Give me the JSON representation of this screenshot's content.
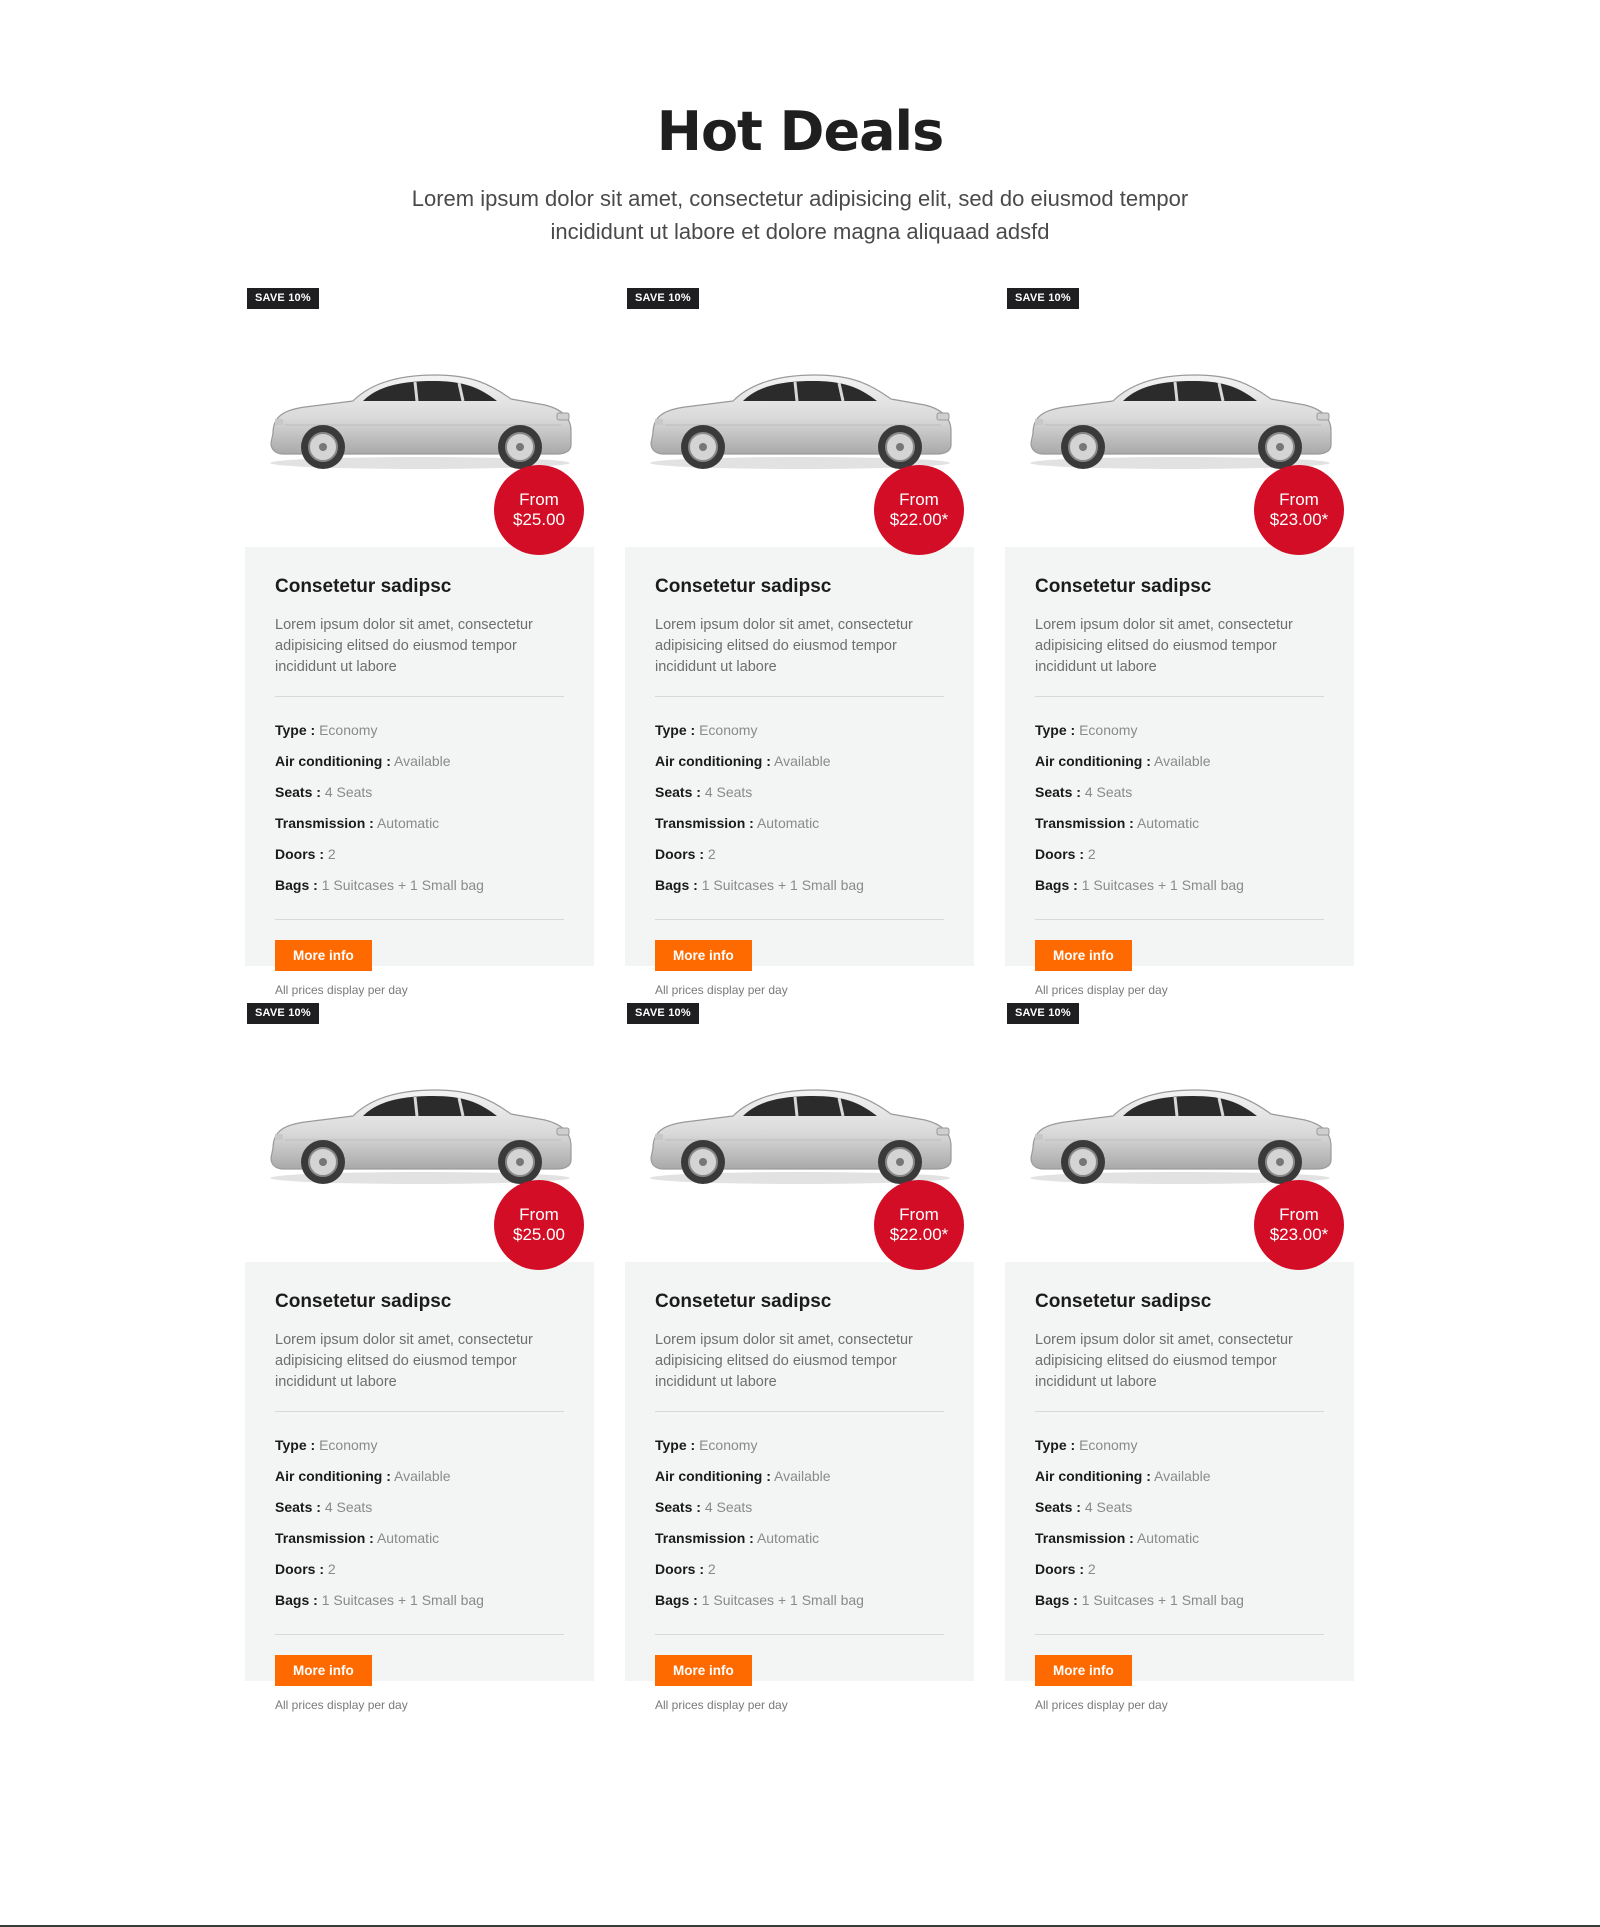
{
  "header": {
    "title": "Hot Deals",
    "subtitle": "Lorem ipsum dolor sit amet, consectetur adipisicing elit, sed do eiusmod tempor incididunt ut labore et dolore magna aliquaad adsfd"
  },
  "colors": {
    "accent_orange": "#ff6a00",
    "price_red": "#d30d25",
    "badge_dark": "#1f1f22",
    "card_bg": "#f3f4f4"
  },
  "spec_labels": {
    "type": "Type :",
    "ac": "Air conditioning :",
    "seats": "Seats :",
    "transmission": "Transmission :",
    "doors": "Doors :",
    "bags": "Bags :"
  },
  "cards": [
    {
      "badge": "SAVE 10%",
      "price_from": "From",
      "price": "$25.00",
      "title": "Consetetur sadipsc",
      "desc": "Lorem ipsum dolor sit amet, consectetur adipisicing elitsed do eiusmod tempor incididunt ut labore",
      "type": "Economy",
      "ac": "Available",
      "seats": "4 Seats",
      "transmission": "Automatic",
      "doors": "2",
      "bags": "1 Suitcases + 1 Small bag",
      "button": "More info",
      "note": "All prices display per day"
    },
    {
      "badge": "SAVE 10%",
      "price_from": "From",
      "price": "$22.00*",
      "title": "Consetetur sadipsc",
      "desc": "Lorem ipsum dolor sit amet, consectetur adipisicing elitsed do eiusmod tempor incididunt ut labore",
      "type": "Economy",
      "ac": "Available",
      "seats": "4 Seats",
      "transmission": "Automatic",
      "doors": "2",
      "bags": "1 Suitcases + 1 Small bag",
      "button": "More info",
      "note": "All prices display per day"
    },
    {
      "badge": "SAVE 10%",
      "price_from": "From",
      "price": "$23.00*",
      "title": "Consetetur sadipsc",
      "desc": "Lorem ipsum dolor sit amet, consectetur adipisicing elitsed do eiusmod tempor incididunt ut labore",
      "type": "Economy",
      "ac": "Available",
      "seats": "4 Seats",
      "transmission": "Automatic",
      "doors": "2",
      "bags": "1 Suitcases + 1 Small bag",
      "button": "More info",
      "note": "All prices display per day"
    },
    {
      "badge": "SAVE 10%",
      "price_from": "From",
      "price": "$25.00",
      "title": "Consetetur sadipsc",
      "desc": "Lorem ipsum dolor sit amet, consectetur adipisicing elitsed do eiusmod tempor incididunt ut labore",
      "type": "Economy",
      "ac": "Available",
      "seats": "4 Seats",
      "transmission": "Automatic",
      "doors": "2",
      "bags": "1 Suitcases + 1 Small bag",
      "button": "More info",
      "note": "All prices display per day"
    },
    {
      "badge": "SAVE 10%",
      "price_from": "From",
      "price": "$22.00*",
      "title": "Consetetur sadipsc",
      "desc": "Lorem ipsum dolor sit amet, consectetur adipisicing elitsed do eiusmod tempor incididunt ut labore",
      "type": "Economy",
      "ac": "Available",
      "seats": "4 Seats",
      "transmission": "Automatic",
      "doors": "2",
      "bags": "1 Suitcases + 1 Small bag",
      "button": "More info",
      "note": "All prices display per day"
    },
    {
      "badge": "SAVE 10%",
      "price_from": "From",
      "price": "$23.00*",
      "title": "Consetetur sadipsc",
      "desc": "Lorem ipsum dolor sit amet, consectetur adipisicing elitsed do eiusmod tempor incididunt ut labore",
      "type": "Economy",
      "ac": "Available",
      "seats": "4 Seats",
      "transmission": "Automatic",
      "doors": "2",
      "bags": "1 Suitcases + 1 Small bag",
      "button": "More info",
      "note": "All prices display per day"
    }
  ]
}
